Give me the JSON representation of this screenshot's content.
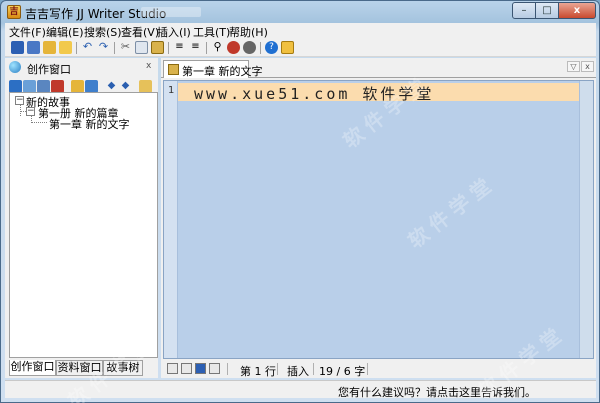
{
  "window": {
    "title": "吉吉写作 JJ Writer Studio",
    "controls": {
      "minimize": "–",
      "maximize": "□",
      "close": "x"
    }
  },
  "menu": [
    {
      "label": "文件(F)"
    },
    {
      "label": "编辑(E)"
    },
    {
      "label": "搜索(S)"
    },
    {
      "label": "查看(V)"
    },
    {
      "label": "插入(I)"
    },
    {
      "label": "工具(T)"
    },
    {
      "label": "帮助(H)"
    }
  ],
  "toolbar": {
    "icons": [
      "save-icon",
      "save-all-icon",
      "open-icon",
      "new-icon",
      "undo-icon",
      "redo-icon",
      "cut-icon",
      "copy-icon",
      "paste-icon",
      "indent-icon",
      "outdent-icon",
      "find-icon",
      "replace-icon",
      "find-next-icon",
      "help-icon",
      "about-icon"
    ],
    "colors": {
      "save": "#2c5fb3",
      "folder": "#e5b53a",
      "undo": "#2a5fb0",
      "cut": "#555555",
      "find": "#333333",
      "help": "#1f6fd1"
    }
  },
  "left_panel": {
    "title": "创作窗口",
    "close_glyph": "x",
    "tree": {
      "root": "新的故事",
      "volume": "第一册 新的篇章",
      "chapter": "第一章 新的文字",
      "expand_glyph": "−"
    },
    "tabs": [
      {
        "label": "创作窗口"
      },
      {
        "label": "资料窗口"
      },
      {
        "label": "故事树"
      }
    ]
  },
  "editor": {
    "tab_label": "第一章 新的文字",
    "line_number": "1",
    "line_text": "www.xue51.com 软件学堂",
    "background": "#b9cfe9",
    "current_line_color": "#fbdcae"
  },
  "status": {
    "line": "第 1 行",
    "mode": "插入",
    "count": "19 / 6 字"
  },
  "win_status": {
    "feedback": "您有什么建议吗？请点击这里告诉我们。"
  },
  "watermark": {
    "text": "软件学堂"
  }
}
